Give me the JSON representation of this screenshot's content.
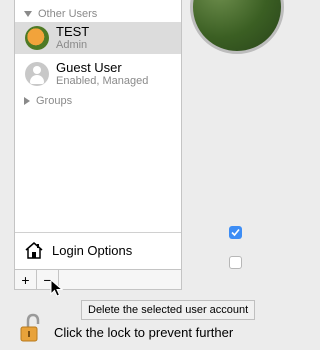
{
  "sidebar": {
    "section_header": "Other Users",
    "users": [
      {
        "name": "TEST",
        "subtitle": "Admin"
      },
      {
        "name": "Guest User",
        "subtitle": "Enabled, Managed"
      }
    ],
    "groups_label": "Groups",
    "login_options_label": "Login Options"
  },
  "toolbar": {
    "add_label": "+",
    "remove_label": "−"
  },
  "tooltip": {
    "text": "Delete the selected user account"
  },
  "footer": {
    "lock_text": "Click the lock to prevent further"
  },
  "colors": {
    "selection": "#dcdcdc",
    "accent": "#3d8df5"
  },
  "icons": [
    "user-avatar-icon",
    "guest-user-icon",
    "house-icon",
    "lock-icon",
    "pointer-cursor-icon",
    "checkmark-icon"
  ]
}
